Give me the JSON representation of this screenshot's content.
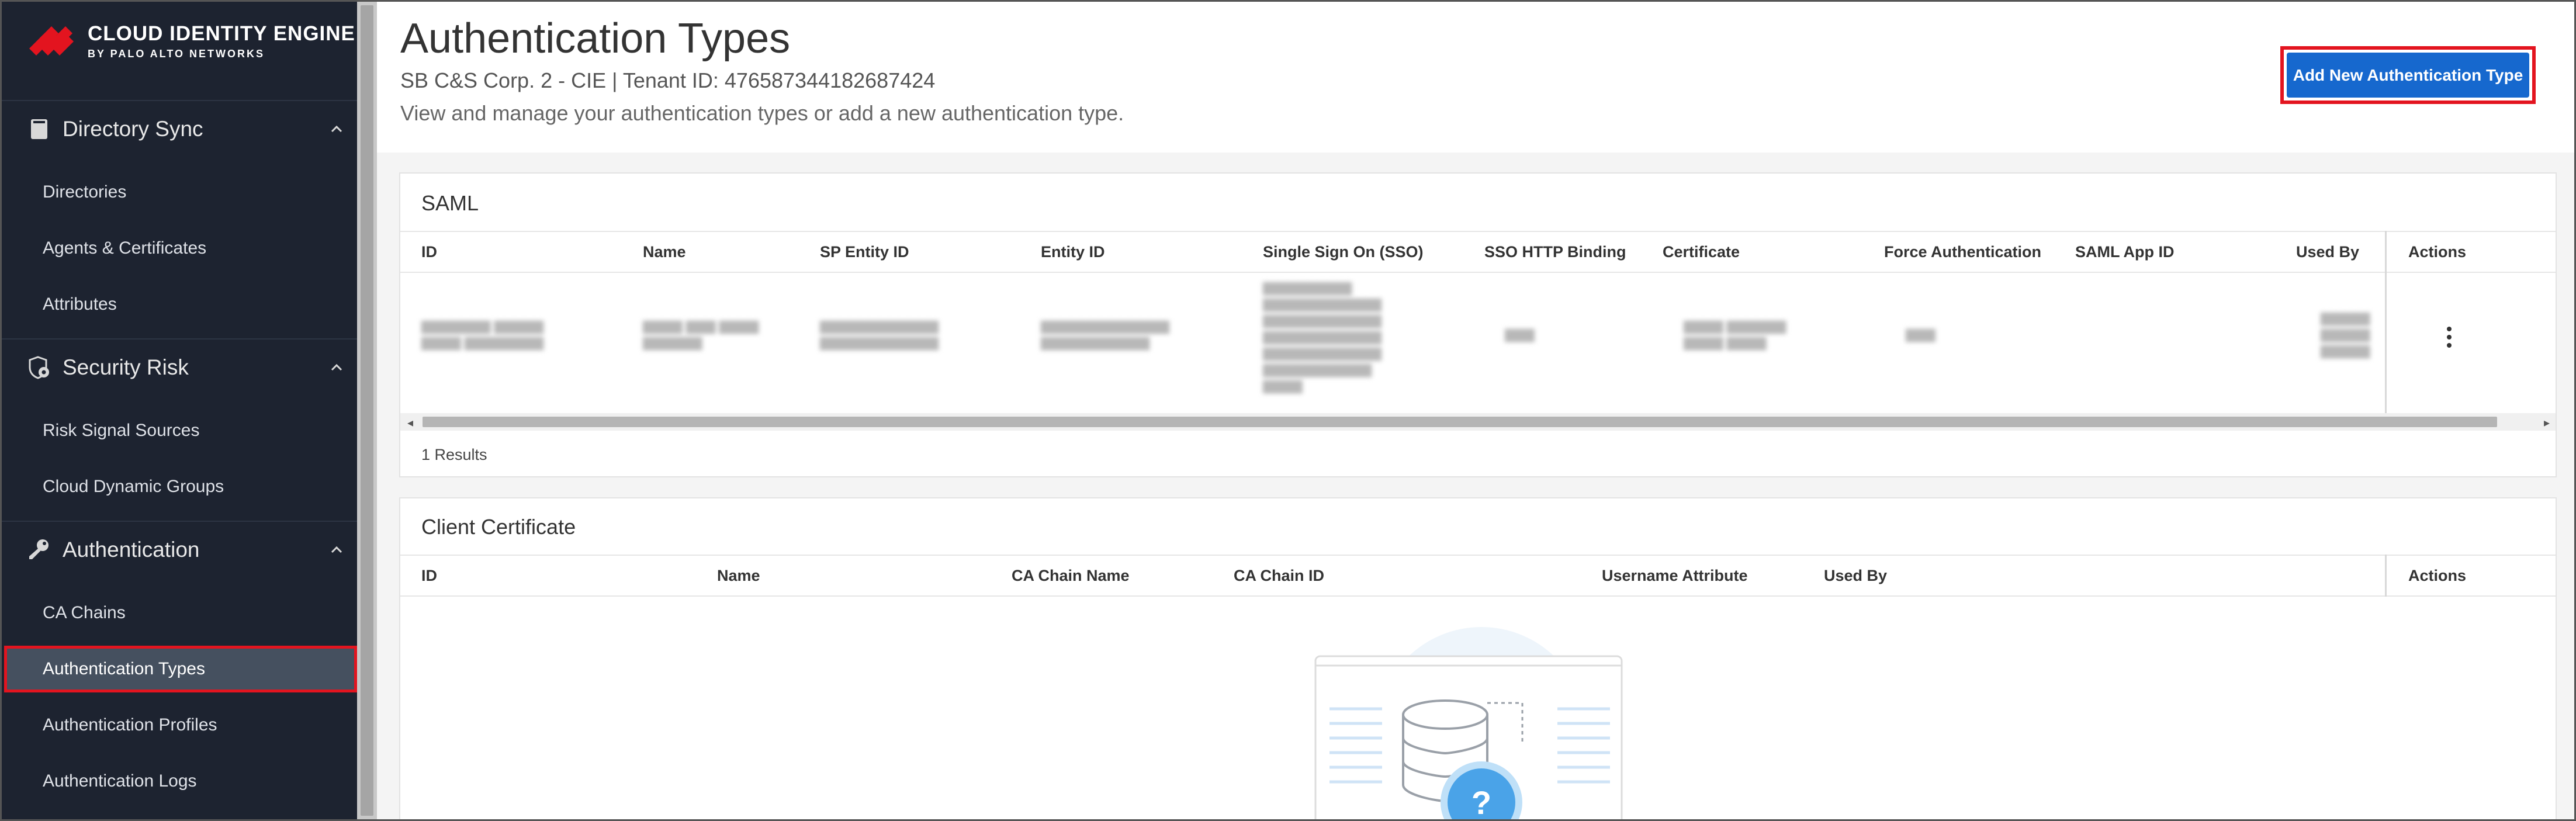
{
  "brand": {
    "title": "CLOUD IDENTITY ENGINE",
    "subtitle": "BY PALO ALTO NETWORKS",
    "accent": "#e3141f"
  },
  "sidebar": {
    "sections": [
      {
        "label": "Directory Sync",
        "icon": "book-icon",
        "items": [
          "Directories",
          "Agents & Certificates",
          "Attributes"
        ]
      },
      {
        "label": "Security Risk",
        "icon": "shield-gear-icon",
        "items": [
          "Risk Signal Sources",
          "Cloud Dynamic Groups"
        ]
      },
      {
        "label": "Authentication",
        "icon": "key-icon",
        "items": [
          "CA Chains",
          "Authentication Types",
          "Authentication Profiles",
          "Authentication Logs"
        ]
      }
    ],
    "active_item": "Authentication Types"
  },
  "header": {
    "title": "Authentication Types",
    "tenant": "SB C&S Corp. 2 - CIE | Tenant ID: 476587344182687424",
    "description": "View and manage your authentication types or add a new authentication type.",
    "add_button": "Add New Authentication Type",
    "primary_color": "#1668ce"
  },
  "saml": {
    "title": "SAML",
    "columns": [
      "ID",
      "Name",
      "SP Entity ID",
      "Entity ID",
      "Single Sign On (SSO)",
      "SSO HTTP Binding",
      "Certificate",
      "Force Authentication",
      "SAML App ID",
      "Used By",
      "Actions"
    ],
    "results": "1 Results"
  },
  "client_cert": {
    "title": "Client Certificate",
    "columns": [
      "ID",
      "Name",
      "CA Chain Name",
      "CA Chain ID",
      "Username Attribute",
      "Used By",
      "Actions"
    ]
  }
}
